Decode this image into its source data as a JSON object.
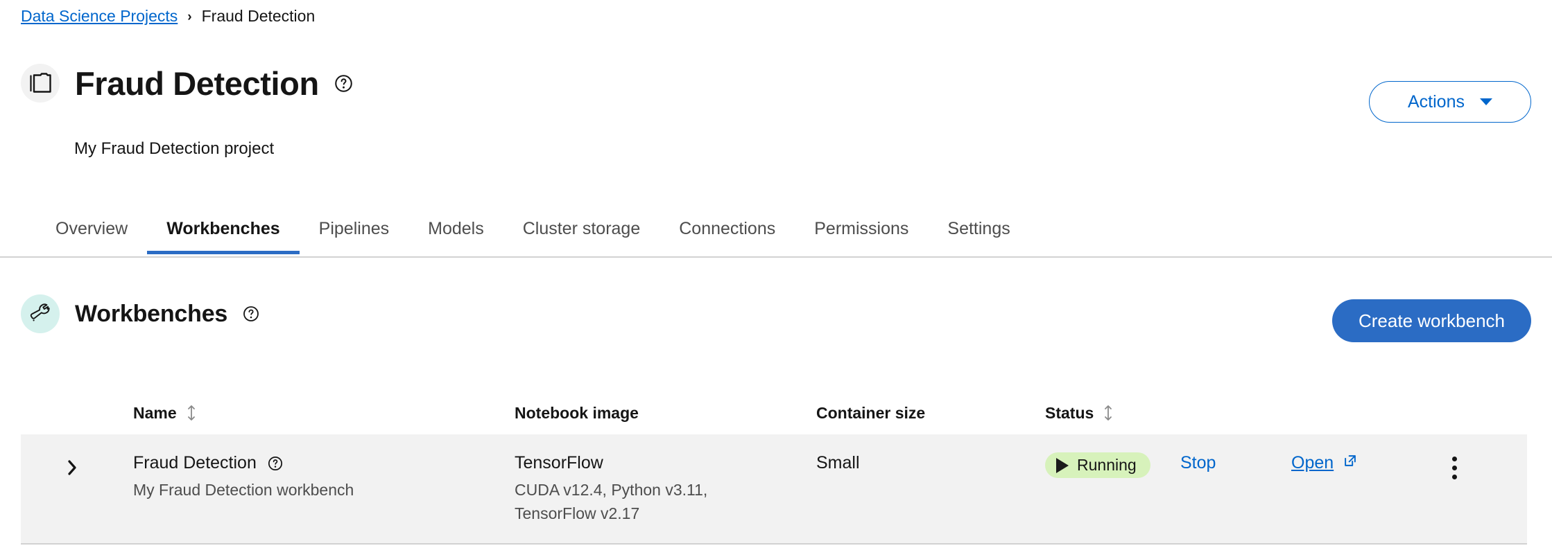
{
  "breadcrumb": {
    "link_label": "Data Science Projects",
    "separator": "›",
    "current_label": "Fraud Detection"
  },
  "header": {
    "icon": "folder-icon",
    "title": "Fraud Detection",
    "help_icon": "help-circle-icon",
    "description": "My Fraud Detection project",
    "actions_button": {
      "label": "Actions",
      "caret_icon": "caret-down-icon"
    }
  },
  "tabs": [
    {
      "label": "Overview",
      "active": false
    },
    {
      "label": "Workbenches",
      "active": true
    },
    {
      "label": "Pipelines",
      "active": false
    },
    {
      "label": "Models",
      "active": false
    },
    {
      "label": "Cluster storage",
      "active": false
    },
    {
      "label": "Connections",
      "active": false
    },
    {
      "label": "Permissions",
      "active": false
    },
    {
      "label": "Settings",
      "active": false
    }
  ],
  "section": {
    "icon": "wrench-icon",
    "title": "Workbenches",
    "help_icon": "help-circle-icon",
    "create_button_label": "Create workbench"
  },
  "table": {
    "columns": {
      "name": "Name",
      "notebook_image": "Notebook image",
      "container_size": "Container size",
      "status": "Status"
    },
    "sortable": [
      "name",
      "status"
    ],
    "rows": [
      {
        "expand_icon": "chevron-right-icon",
        "name": "Fraud Detection",
        "name_help_icon": "help-circle-icon",
        "description": "My Fraud Detection workbench",
        "notebook_image": "TensorFlow",
        "notebook_image_details_line1": "CUDA v12.4, Python v3.11,",
        "notebook_image_details_line2": "TensorFlow v2.17",
        "container_size": "Small",
        "status": "Running",
        "status_icon": "play-icon",
        "stop_label": "Stop",
        "open_label": "Open",
        "open_icon": "external-link-icon",
        "kebab_icon": "kebab-menu-icon"
      }
    ]
  },
  "colors": {
    "link": "#0066cc",
    "primary_button": "#2b6cc4",
    "active_tab_underline": "#2b6cc4",
    "status_running_bg": "#d7f2bb",
    "row_bg": "#f2f2f2",
    "project_icon_bg": "#f2f2f2",
    "section_icon_bg": "#d5f1ed",
    "text": "#151515",
    "muted_text": "#4d4d4d",
    "border": "#d2d2d2"
  }
}
